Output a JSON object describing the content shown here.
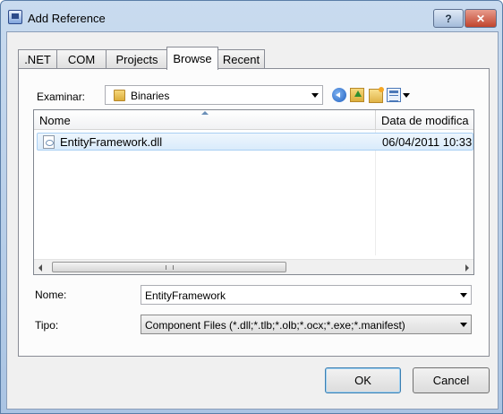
{
  "window": {
    "title": "Add Reference",
    "help_label": "?",
    "close_label": "✕"
  },
  "tabs": [
    {
      "label": ".NET",
      "active": false
    },
    {
      "label": "COM",
      "active": false
    },
    {
      "label": "Projects",
      "active": false
    },
    {
      "label": "Browse",
      "active": true
    },
    {
      "label": "Recent",
      "active": false
    }
  ],
  "look_in": {
    "label": "Examinar:",
    "value": "Binaries"
  },
  "toolbar": {
    "icons": [
      "back-icon",
      "up-folder-icon",
      "new-folder-icon",
      "views-icon"
    ]
  },
  "file_list": {
    "columns": [
      "Nome",
      "Data de modifica"
    ],
    "rows": [
      {
        "name": "EntityFramework.dll",
        "date": "06/04/2011 10:33"
      }
    ],
    "scrollbar_grip": "III"
  },
  "file_name": {
    "label": "Nome:",
    "value": "EntityFramework"
  },
  "file_type": {
    "label": "Tipo:",
    "value": "Component Files (*.dll;*.tlb;*.olb;*.ocx;*.exe;*.manifest)"
  },
  "buttons": {
    "ok": "OK",
    "cancel": "Cancel"
  }
}
